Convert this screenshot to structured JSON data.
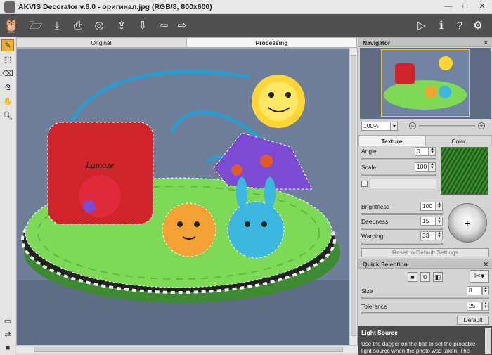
{
  "window": {
    "title": "AKVIS Decorator v.6.0 - оригинал.jpg (RGB/8, 800x600)",
    "min": "—",
    "max": "□",
    "close": "✕"
  },
  "toolbar": {
    "left_icons": [
      "open-icon",
      "save-icon",
      "print-icon",
      "share-icon",
      "export-icon",
      "import-icon",
      "undo-icon",
      "redo-icon"
    ],
    "right_icons": [
      "run-icon",
      "info-icon",
      "help-icon",
      "settings-icon"
    ]
  },
  "tabs": {
    "original": "Original",
    "processing": "Processing"
  },
  "navigator": {
    "title": "Navigator",
    "zoom": "100%"
  },
  "texture_panel": {
    "tab_texture": "Texture",
    "tab_color": "Color",
    "angle_label": "Angle",
    "angle": "0",
    "scale_label": "Scale",
    "scale": "100",
    "brightness_label": "Brightness",
    "brightness": "100",
    "deepness_label": "Deepness",
    "deepness": "15",
    "warping_label": "Warping",
    "warping": "33",
    "reset": "Reset to Default Settings"
  },
  "quick_selection": {
    "title": "Quick Selection",
    "size_label": "Size",
    "size": "8",
    "tolerance_label": "Tolerance",
    "tolerance": "25",
    "default": "Default"
  },
  "light_source": {
    "title": "Light Source",
    "text": "Use the dagger on the ball to set the probable light source when the photo was taken. The"
  },
  "colors": {
    "accent": "#f0b030",
    "toolbar": "#505050",
    "photo_bg": "#6f7f99",
    "grass": "#7ed957"
  }
}
